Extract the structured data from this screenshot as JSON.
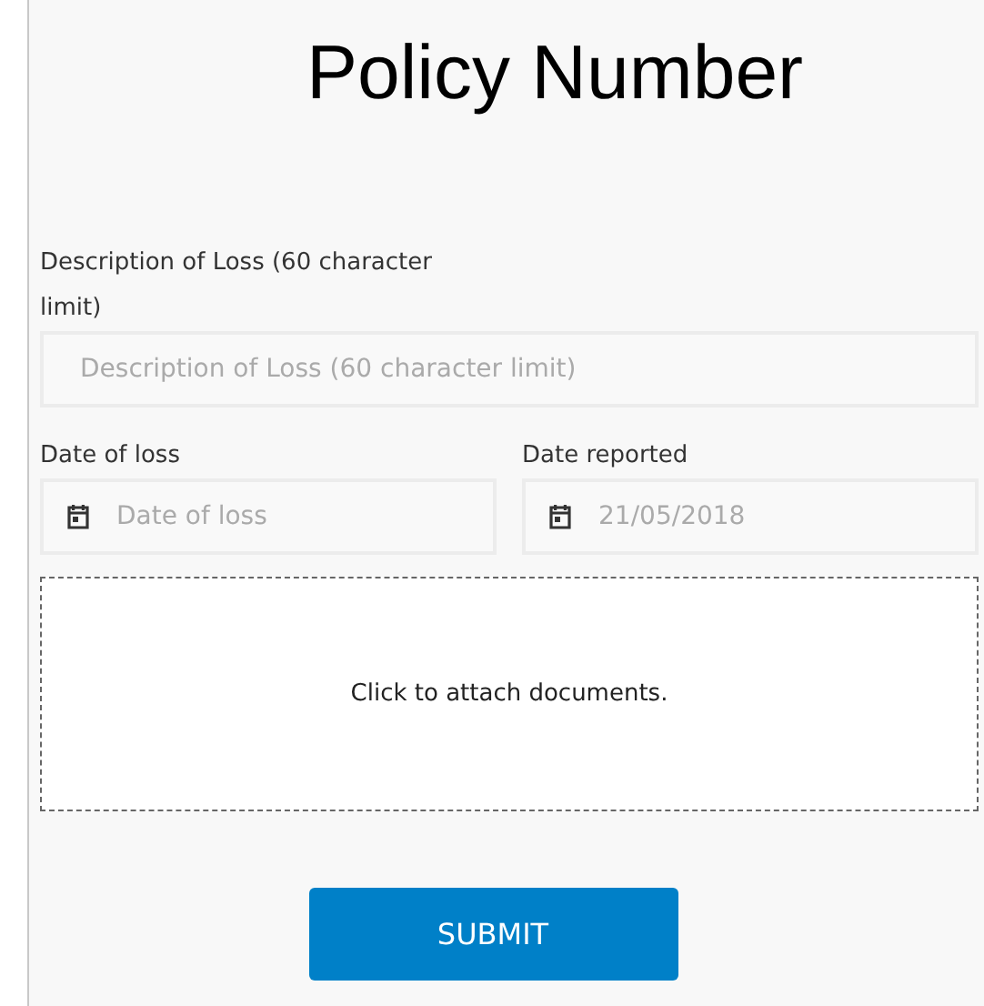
{
  "title": "Policy Number",
  "description": {
    "label": "Description of Loss (60 character limit)",
    "placeholder": "Description of Loss (60 character limit)"
  },
  "date_fields": [
    {
      "label": "Date of loss",
      "placeholder": "Date of loss"
    },
    {
      "label": "Date reported",
      "value": "21/05/2018"
    }
  ],
  "attach": {
    "text": "Click to attach documents."
  },
  "submit": "SUBMIT"
}
